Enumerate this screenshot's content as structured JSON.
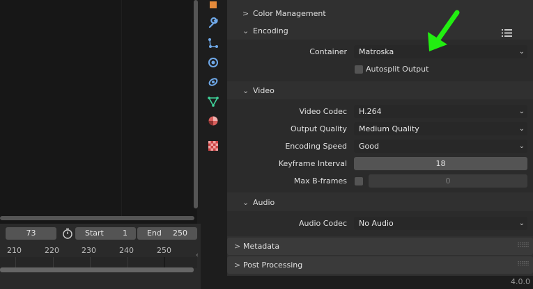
{
  "timeline": {
    "current_frame": "73",
    "start_label": "Start",
    "start_value": "1",
    "end_label": "End",
    "end_value": "250",
    "ticks": [
      "210",
      "220",
      "230",
      "240",
      "250"
    ]
  },
  "properties": {
    "color_management": "Color Management",
    "encoding": {
      "title": "Encoding",
      "container_label": "Container",
      "container_value": "Matroska",
      "autosplit_label": "Autosplit Output"
    },
    "video": {
      "title": "Video",
      "codec_label": "Video Codec",
      "codec_value": "H.264",
      "quality_label": "Output Quality",
      "quality_value": "Medium Quality",
      "speed_label": "Encoding Speed",
      "speed_value": "Good",
      "keyframe_label": "Keyframe Interval",
      "keyframe_value": "18",
      "bframes_label": "Max B-frames",
      "bframes_value": "0"
    },
    "audio": {
      "title": "Audio",
      "codec_label": "Audio Codec",
      "codec_value": "No Audio"
    },
    "metadata": "Metadata",
    "post_processing": "Post Processing"
  },
  "status": {
    "version": "4.0.0"
  },
  "colors": {
    "arrow": "#22ee11",
    "accent": "#e6e6e6"
  },
  "tabs": [
    "object-icon",
    "modifier-wrench-icon",
    "particles-icon",
    "physics-icon",
    "constraints-icon",
    "data-mesh-icon",
    "material-icon",
    "texture-icon"
  ]
}
